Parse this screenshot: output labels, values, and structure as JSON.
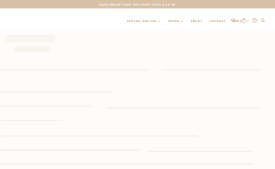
{
  "promo": {
    "text": "WORLDWIDE FREE DELIVERY OVER SIZE 35"
  },
  "nav": {
    "items": [
      {
        "label": "SPECIAL EDITION",
        "has_dropdown": true
      },
      {
        "label": "SHOES",
        "has_dropdown": true
      },
      {
        "label": "ABOUT",
        "has_dropdown": false
      },
      {
        "label": "CONTACT",
        "has_dropdown": false
      },
      {
        "label": "BLOG",
        "has_dropdown": false
      }
    ]
  },
  "actions": {
    "wishlist_count": "0",
    "cart_count": "0"
  },
  "icons": [
    "heart-icon",
    "bag-icon",
    "user-icon",
    "search-icon"
  ],
  "colors": {
    "promo_bg": "#d9c1a6",
    "accent": "#c09a7a",
    "background": "#fdfcfa"
  }
}
